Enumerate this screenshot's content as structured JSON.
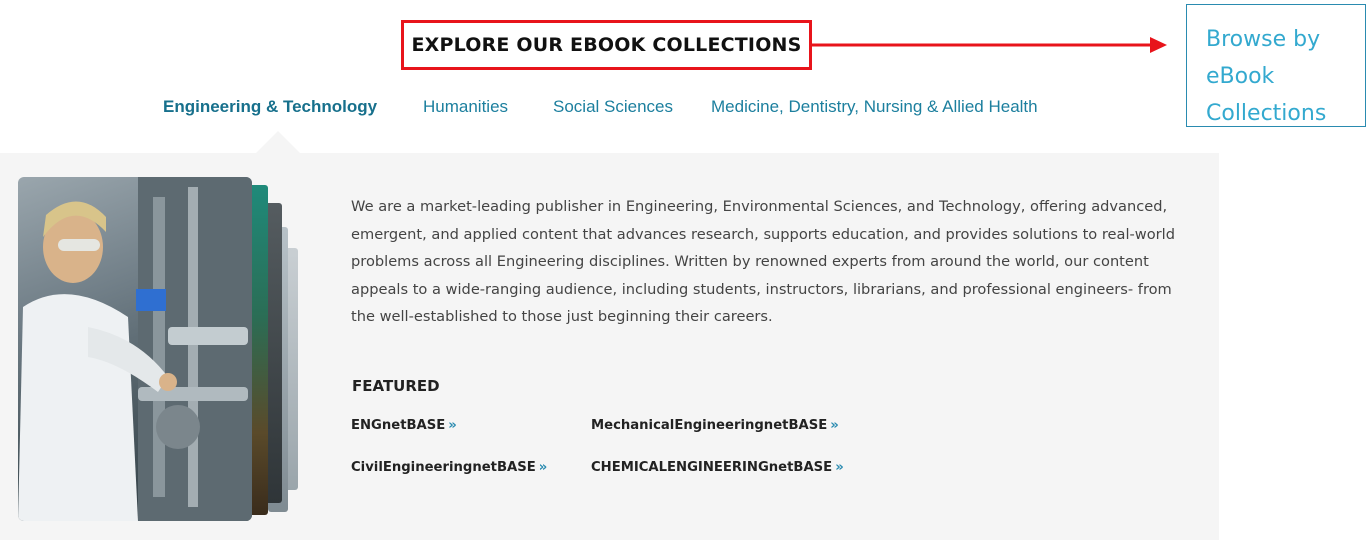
{
  "heading": "EXPLORE OUR EBOOK COLLECTIONS",
  "callout": {
    "lines": [
      "Browse by",
      "eBook",
      "Collections"
    ]
  },
  "tabs": [
    {
      "label": "Engineering & Technology",
      "active": true
    },
    {
      "label": "Humanities",
      "active": false
    },
    {
      "label": "Social Sciences",
      "active": false
    },
    {
      "label": "Medicine, Dentistry, Nursing & Allied Health",
      "active": false
    }
  ],
  "panel": {
    "description_lines": [
      "We are a market-leading publisher in Engineering, Environmental Sciences, and Technology, offering advanced,",
      "emergent, and applied content that advances research, supports education, and provides solutions to real-world",
      "problems across all Engineering disciplines.  Written by renowned experts from around the world, our content",
      "appeals to a wide-ranging audience, including students, instructors, librarians, and professional engineers- from",
      "the well-established to those just beginning their careers."
    ],
    "featured_label": "FEATURED",
    "featured_links": [
      {
        "label": "ENGnetBASE"
      },
      {
        "label": "MechanicalEngineeringnetBASE"
      },
      {
        "label": "CivilEngineeringnetBASE"
      },
      {
        "label": "CHEMICALENGINEERINGnetBASE"
      }
    ],
    "link_chevron": "»"
  },
  "colors": {
    "highlight_red": "#e8141b",
    "tab_blue": "#1c7f9e",
    "callout_blue": "#33a9cf",
    "panel_bg": "#f5f5f5"
  }
}
